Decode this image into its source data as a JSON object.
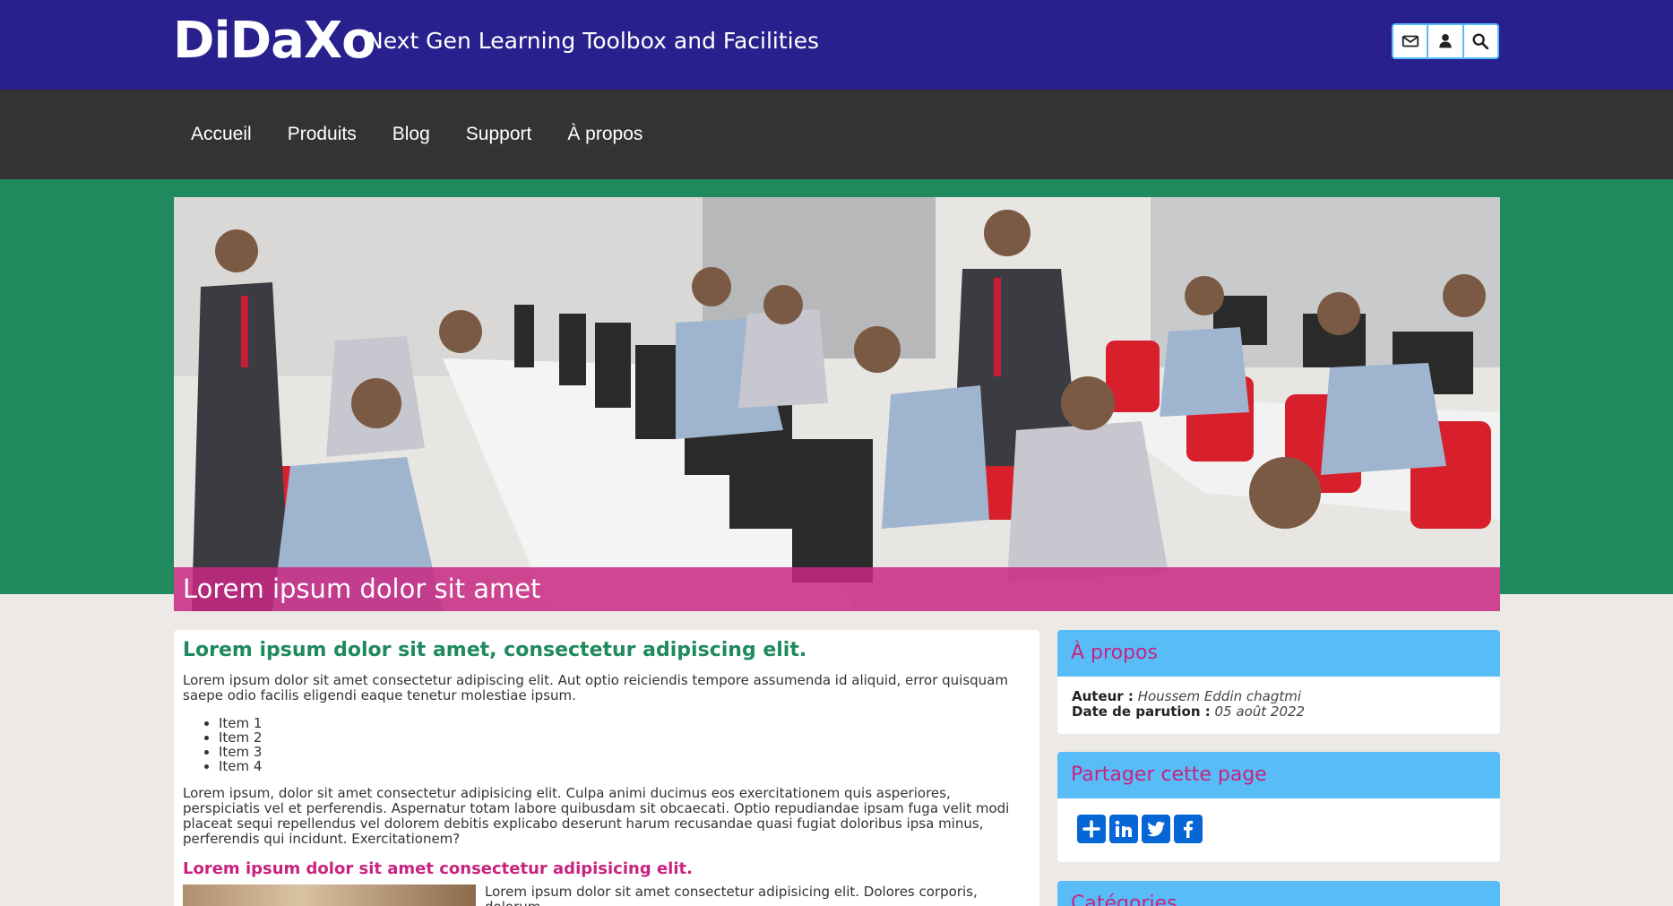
{
  "header": {
    "logo": "DiDaXo",
    "tagline": "Next Gen Learning Toolbox and Facilities",
    "icons": [
      "envelope-icon",
      "user-icon",
      "search-icon"
    ]
  },
  "nav": {
    "items": [
      {
        "label": "Accueil"
      },
      {
        "label": "Produits"
      },
      {
        "label": "Blog"
      },
      {
        "label": "Support"
      },
      {
        "label": "À propos"
      }
    ]
  },
  "hero": {
    "caption": "Lorem ipsum dolor sit amet"
  },
  "article": {
    "title": "Lorem ipsum dolor sit amet, consectetur adipiscing elit.",
    "intro": "Lorem ipsum dolor sit amet consectetur adipiscing elit. Aut optio reiciendis tempore assumenda id aliquid, error quisquam saepe odio facilis eligendi eaque tenetur molestiae ipsum.",
    "list": [
      "Item 1",
      "Item 2",
      "Item 3",
      "Item 4"
    ],
    "body": "Lorem ipsum, dolor sit amet consectetur adipisicing elit. Culpa animi ducimus eos exercitationem quis asperiores, perspiciatis vel et perferendis. Aspernatur totam labore quibusdam sit obcaecati. Optio repudiandae ipsam fuga velit modi placeat sequi repellendus vel dolorem debitis explicabo deserunt harum recusandae quasi fugiat doloribus ipsa minus, perferendis qui incidunt. Exercitationem?",
    "subtitle": "Lorem ipsum dolor sit amet consectetur adipisicing elit.",
    "bottom_text": "Lorem ipsum dolor sit amet consectetur adipisicing elit. Dolores corporis, dolorum"
  },
  "sidebar": {
    "about": {
      "title": "À propos",
      "author_label": "Auteur :",
      "author": "Houssem Eddin chagtmi",
      "date_label": "Date de parution :",
      "date": "05 août 2022"
    },
    "share": {
      "title": "Partager cette page",
      "buttons": [
        "plus-icon",
        "linkedin-icon",
        "twitter-icon",
        "facebook-icon"
      ]
    },
    "categories": {
      "title": "Catégories"
    }
  },
  "colors": {
    "header_bg": "#28208c",
    "nav_bg": "#333333",
    "green_band": "#1f8a5e",
    "accent_pink": "#c8237f",
    "accent_blue": "#58bdf7",
    "share_blue": "#0666d6"
  }
}
